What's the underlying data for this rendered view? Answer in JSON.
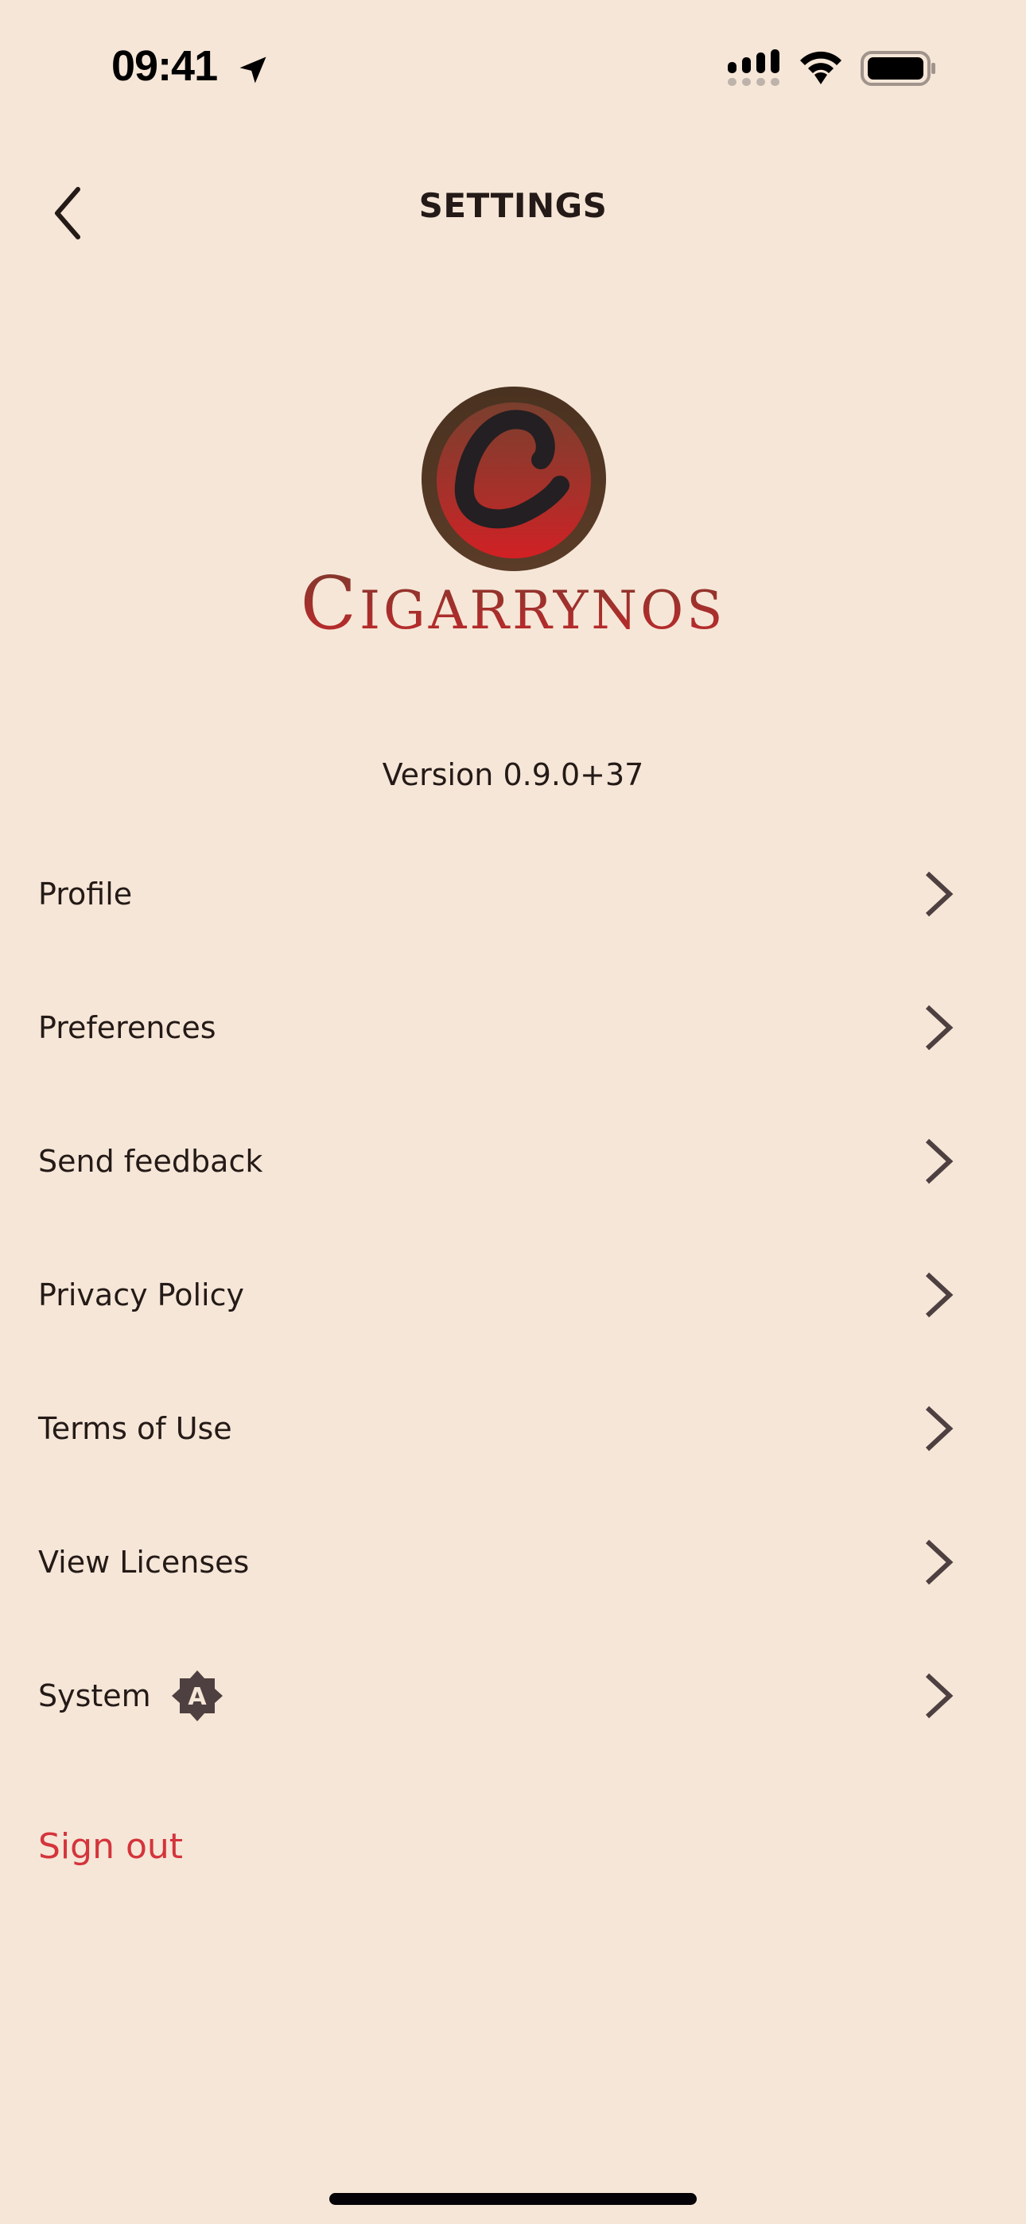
{
  "status_bar": {
    "time": "09:41",
    "location_icon": "location-arrow-icon",
    "signal_icon": "cellular-signal-icon",
    "wifi_icon": "wifi-icon",
    "battery_icon": "battery-full-icon"
  },
  "nav": {
    "back_icon": "chevron-left-icon",
    "title": "SETTINGS"
  },
  "logo": {
    "emblem_letter": "C",
    "wordmark_first": "C",
    "wordmark_rest": "IGARRYNOS",
    "colors": {
      "ring": "#4e3424",
      "inner_top": "#7a3a2e",
      "inner_bottom": "#cc2226",
      "letter": "#231f22",
      "wordmark": "#a12a26"
    }
  },
  "version_text": "Version 0.9.0+37",
  "menu": {
    "items": [
      {
        "label": "Profile",
        "icon": "chevron-right-icon"
      },
      {
        "label": "Preferences",
        "icon": "chevron-right-icon"
      },
      {
        "label": "Send feedback",
        "icon": "chevron-right-icon"
      },
      {
        "label": "Privacy Policy",
        "icon": "chevron-right-icon"
      },
      {
        "label": "Terms of Use",
        "icon": "chevron-right-icon"
      },
      {
        "label": "View Licenses",
        "icon": "chevron-right-icon"
      },
      {
        "label": "System",
        "icon": "chevron-right-icon",
        "badge_icon": "brightness-auto-icon",
        "badge_letter": "A"
      }
    ]
  },
  "sign_out_label": "Sign out",
  "colors": {
    "background": "#f6e6d7",
    "text": "#241a17",
    "chevron": "#4e4040",
    "danger": "#d4343c"
  }
}
